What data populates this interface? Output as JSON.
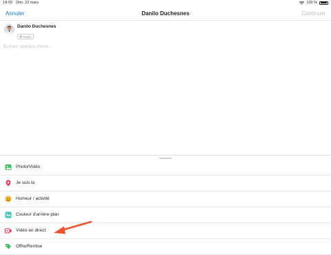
{
  "status_bar": {
    "time": "14:09",
    "date": "Dim. 22 mars",
    "battery": "100 %"
  },
  "nav": {
    "cancel_label": "Annuler",
    "title": "Danilo Duchesnes",
    "continue_label": "Continuer"
  },
  "author": {
    "name": "Danilo Duchesnes",
    "privacy_label": "Public"
  },
  "composer": {
    "placeholder": "Écrivez quelque chose..."
  },
  "options": [
    {
      "label": "Photo/Vidéo",
      "icon": "photo-video-icon",
      "color": "#45bd62"
    },
    {
      "label": "Je suis là",
      "icon": "location-pin-icon",
      "color": "#f3425f"
    },
    {
      "label": "Humeur / activité",
      "icon": "smiley-icon",
      "color": "#f7b928"
    },
    {
      "label": "Couleur d'arrière-plan",
      "icon": "background-color-icon",
      "color": "#3ec3b9"
    },
    {
      "label": "Vidéo en direct",
      "icon": "live-video-icon",
      "color": "#e42645"
    },
    {
      "label": "Offre/Remise",
      "icon": "offer-tag-icon",
      "color": "#45bd62"
    }
  ],
  "colors": {
    "accent": "#1877f2",
    "disabled": "#bcc0c4",
    "annotation": "#f0522f"
  }
}
